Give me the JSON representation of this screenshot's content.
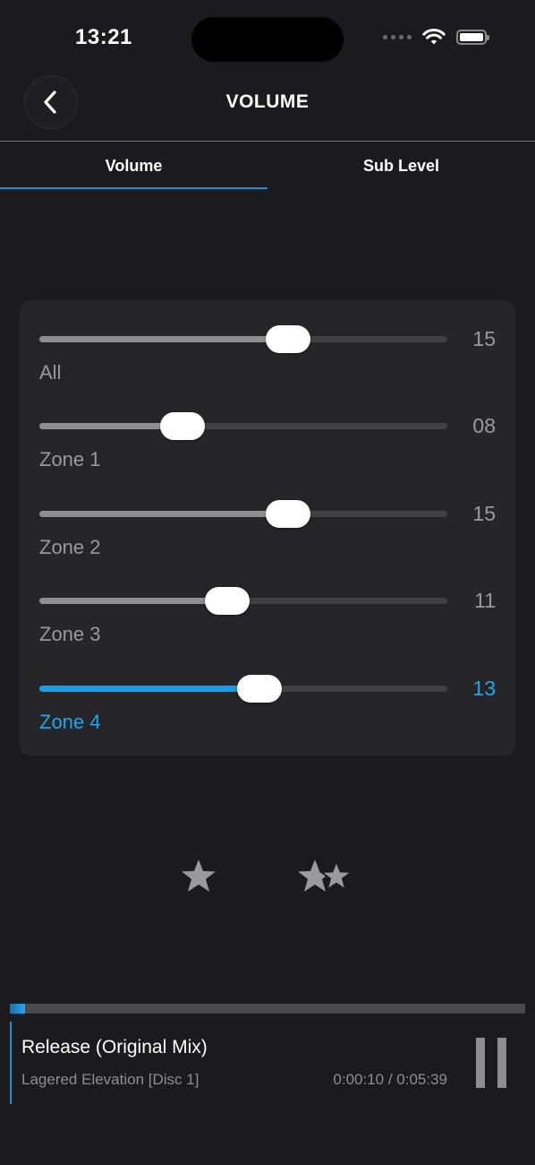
{
  "status_bar": {
    "time": "13:21"
  },
  "header": {
    "title": "VOLUME",
    "back_icon": "chevron-left-icon"
  },
  "tabs": [
    {
      "label": "Volume",
      "active": true
    },
    {
      "label": "Sub Level",
      "active": false
    }
  ],
  "colors": {
    "accent": "#0fa0ee",
    "background": "#1b1b1d",
    "card": "#262628"
  },
  "zones": [
    {
      "label": "All",
      "value": "15",
      "level": 0.61,
      "active": false
    },
    {
      "label": "Zone 1",
      "value": "08",
      "level": 0.35,
      "active": false
    },
    {
      "label": "Zone 2",
      "value": "15",
      "level": 0.61,
      "active": false
    },
    {
      "label": "Zone 3",
      "value": "11",
      "level": 0.46,
      "active": false
    },
    {
      "label": "Zone 4",
      "value": "13",
      "level": 0.54,
      "active": true
    }
  ],
  "favorites": {
    "single_icon": "star-icon",
    "double_icon": "double-star-icon"
  },
  "player": {
    "title": "Release (Original Mix)",
    "album": "Lagered Elevation [Disc 1]",
    "time": "0:00:10 / 0:05:39",
    "progress": 0.03,
    "pause_icon": "pause-icon"
  }
}
